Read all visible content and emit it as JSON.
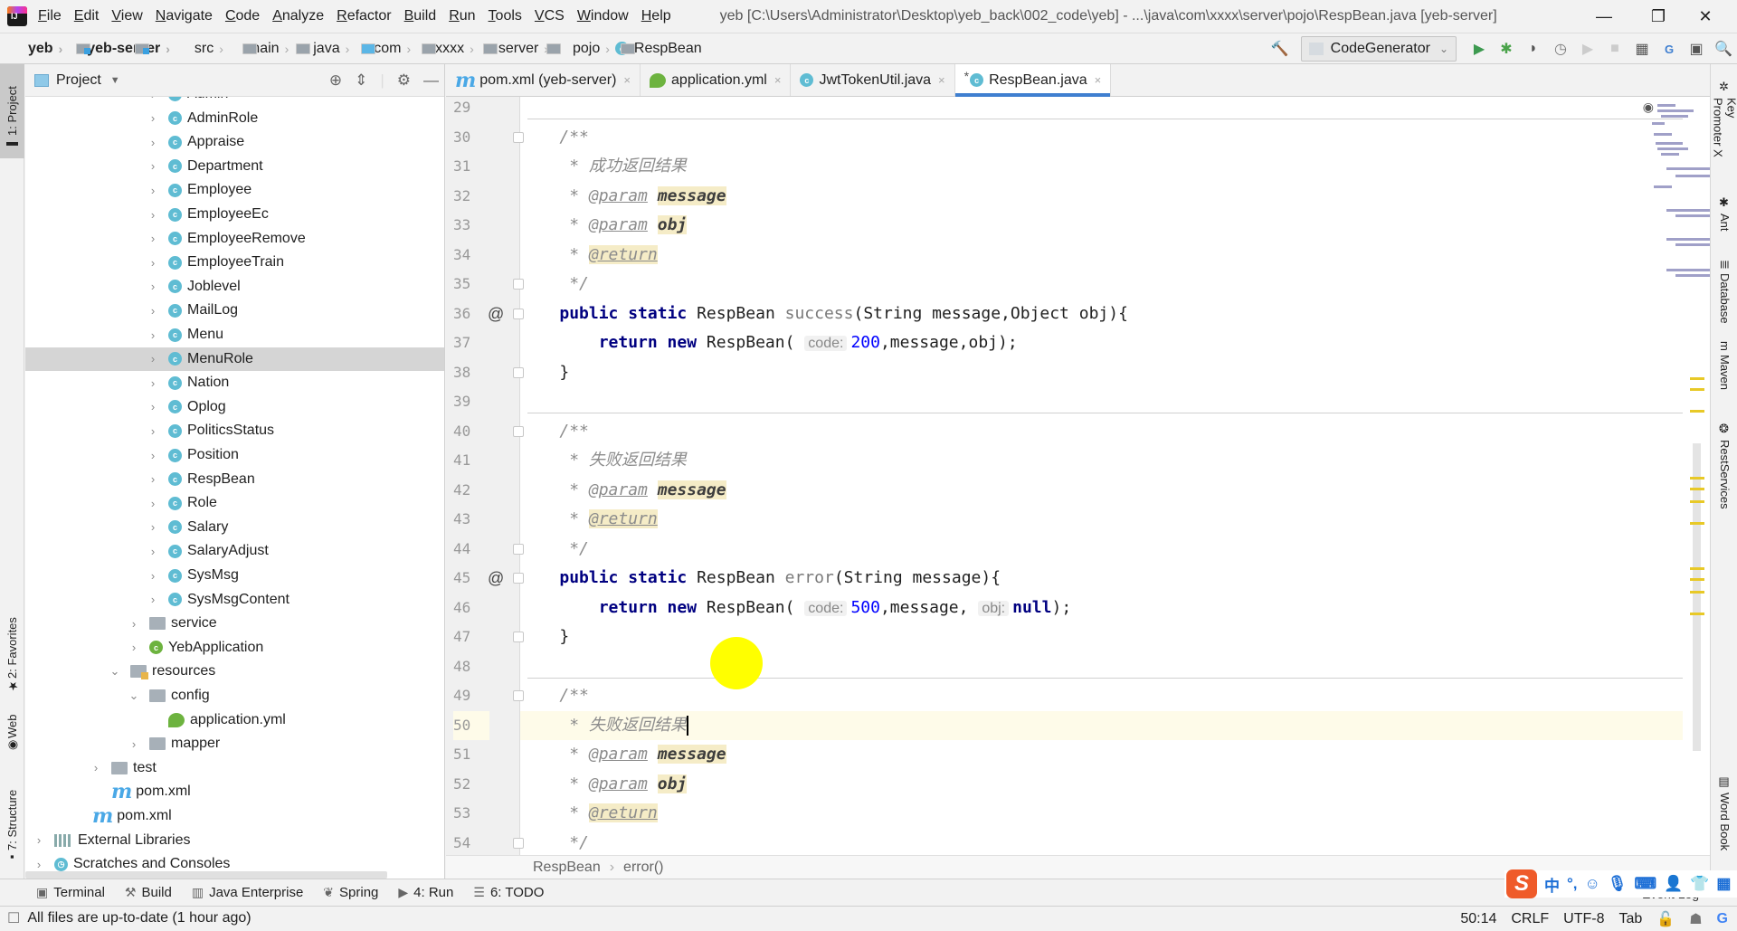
{
  "window": {
    "title": "yeb [C:\\Users\\Administrator\\Desktop\\yeb_back\\002_code\\yeb] - ...\\java\\com\\xxxx\\server\\pojo\\RespBean.java [yeb-server]",
    "minimize": "—",
    "maximize": "❐",
    "close": "✕"
  },
  "menu": [
    "File",
    "Edit",
    "View",
    "Navigate",
    "Code",
    "Analyze",
    "Refactor",
    "Build",
    "Run",
    "Tools",
    "VCS",
    "Window",
    "Help"
  ],
  "breadcrumb": [
    "yeb",
    "yeb-server",
    "src",
    "main",
    "java",
    "com",
    "xxxx",
    "server",
    "pojo",
    "RespBean"
  ],
  "toolbar": {
    "run_config": "CodeGenerator",
    "icons": [
      "hammer-icon",
      "run-icon",
      "debug-icon",
      "coverage-icon",
      "profile-icon",
      "run-disabled-icon",
      "stop-icon",
      "project-structure-icon",
      "translate-icon",
      "terminal-icon",
      "search-icon"
    ]
  },
  "left_stripe": {
    "top": [
      "1: Project"
    ],
    "bottom": [
      "2: Favorites",
      "Web",
      "7: Structure"
    ]
  },
  "right_stripe": [
    "Key Promoter X",
    "Ant",
    "Database",
    "Maven",
    "RestServices",
    "Word Book"
  ],
  "project_panel": {
    "title": "Project",
    "tree": [
      {
        "label": "Admin",
        "type": "class",
        "indent": 6,
        "arrow": "›"
      },
      {
        "label": "AdminRole",
        "type": "class",
        "indent": 6,
        "arrow": "›"
      },
      {
        "label": "Appraise",
        "type": "class",
        "indent": 6,
        "arrow": "›"
      },
      {
        "label": "Department",
        "type": "class",
        "indent": 6,
        "arrow": "›"
      },
      {
        "label": "Employee",
        "type": "class",
        "indent": 6,
        "arrow": "›"
      },
      {
        "label": "EmployeeEc",
        "type": "class",
        "indent": 6,
        "arrow": "›"
      },
      {
        "label": "EmployeeRemove",
        "type": "class",
        "indent": 6,
        "arrow": "›"
      },
      {
        "label": "EmployeeTrain",
        "type": "class",
        "indent": 6,
        "arrow": "›"
      },
      {
        "label": "Joblevel",
        "type": "class",
        "indent": 6,
        "arrow": "›"
      },
      {
        "label": "MailLog",
        "type": "class",
        "indent": 6,
        "arrow": "›"
      },
      {
        "label": "Menu",
        "type": "class",
        "indent": 6,
        "arrow": "›"
      },
      {
        "label": "MenuRole",
        "type": "class",
        "indent": 6,
        "arrow": "›",
        "selected": true
      },
      {
        "label": "Nation",
        "type": "class",
        "indent": 6,
        "arrow": "›"
      },
      {
        "label": "Oplog",
        "type": "class",
        "indent": 6,
        "arrow": "›"
      },
      {
        "label": "PoliticsStatus",
        "type": "class",
        "indent": 6,
        "arrow": "›"
      },
      {
        "label": "Position",
        "type": "class",
        "indent": 6,
        "arrow": "›"
      },
      {
        "label": "RespBean",
        "type": "class",
        "indent": 6,
        "arrow": "›"
      },
      {
        "label": "Role",
        "type": "class",
        "indent": 6,
        "arrow": "›"
      },
      {
        "label": "Salary",
        "type": "class",
        "indent": 6,
        "arrow": "›"
      },
      {
        "label": "SalaryAdjust",
        "type": "class",
        "indent": 6,
        "arrow": "›"
      },
      {
        "label": "SysMsg",
        "type": "class",
        "indent": 6,
        "arrow": "›"
      },
      {
        "label": "SysMsgContent",
        "type": "class",
        "indent": 6,
        "arrow": "›"
      },
      {
        "label": "service",
        "type": "folder",
        "indent": 5,
        "arrow": "›"
      },
      {
        "label": "YebApplication",
        "type": "spring-class",
        "indent": 5,
        "arrow": "›"
      },
      {
        "label": "resources",
        "type": "res-folder",
        "indent": 4,
        "arrow": "⌄"
      },
      {
        "label": "config",
        "type": "folder",
        "indent": 5,
        "arrow": "⌄"
      },
      {
        "label": "application.yml",
        "type": "yml",
        "indent": 6,
        "arrow": ""
      },
      {
        "label": "mapper",
        "type": "folder",
        "indent": 5,
        "arrow": "›"
      },
      {
        "label": "test",
        "type": "folder",
        "indent": 3,
        "arrow": "›"
      },
      {
        "label": "pom.xml",
        "type": "maven",
        "indent": 3,
        "arrow": ""
      },
      {
        "label": "pom.xml",
        "type": "maven",
        "indent": 2,
        "arrow": ""
      },
      {
        "label": "External Libraries",
        "type": "libs",
        "indent": 0,
        "arrow": "›"
      },
      {
        "label": "Scratches and Consoles",
        "type": "scratches",
        "indent": 0,
        "arrow": "›"
      }
    ]
  },
  "editor_tabs": [
    {
      "label": "pom.xml (yeb-server)",
      "icon": "maven",
      "active": false
    },
    {
      "label": "application.yml",
      "icon": "yml",
      "active": false
    },
    {
      "label": "JwtTokenUtil.java",
      "icon": "class",
      "active": false
    },
    {
      "label": "RespBean.java",
      "icon": "class",
      "active": true,
      "modified": true
    }
  ],
  "editor": {
    "cursor_line": 50,
    "lines": [
      {
        "n": 29,
        "html": ""
      },
      {
        "n": 30,
        "html": "    <span class='cm'>/**</span>"
      },
      {
        "n": 31,
        "html": "     <span class='cm'>* 成功返回结果</span>"
      },
      {
        "n": 32,
        "html": "     <span class='cm'>* </span><span class='tag'>@param</span> <span class='pname'>message</span>"
      },
      {
        "n": 33,
        "html": "     <span class='cm'>* </span><span class='tag'>@param</span> <span class='pname'>obj</span>"
      },
      {
        "n": 34,
        "html": "     <span class='cm'>* </span><span class='tag hl'>@return</span>"
      },
      {
        "n": 35,
        "html": "     <span class='cm'>*/</span>"
      },
      {
        "n": 36,
        "html": "    <span class='kw'>public static</span> RespBean <span class='fn'>success</span>(String message,Object obj){",
        "at": true
      },
      {
        "n": 37,
        "html": "        <span class='kw'>return new</span> RespBean( <span class='hint'>code:</span><span class='num'>200</span>,message,obj);"
      },
      {
        "n": 38,
        "html": "    }"
      },
      {
        "n": 39,
        "html": ""
      },
      {
        "n": 40,
        "html": "    <span class='cm'>/**</span>"
      },
      {
        "n": 41,
        "html": "     <span class='cm'>* 失败返回结果</span>"
      },
      {
        "n": 42,
        "html": "     <span class='cm'>* </span><span class='tag'>@param</span> <span class='pname'>message</span>"
      },
      {
        "n": 43,
        "html": "     <span class='cm'>* </span><span class='tag hl'>@return</span>"
      },
      {
        "n": 44,
        "html": "     <span class='cm'>*/</span>"
      },
      {
        "n": 45,
        "html": "    <span class='kw'>public static</span> RespBean <span class='fn'>error</span>(String message){",
        "at": true
      },
      {
        "n": 46,
        "html": "        <span class='kw'>return new</span> RespBean( <span class='hint'>code:</span><span class='num'>500</span>,message, <span class='hint'>obj:</span><span class='kw'>null</span>);"
      },
      {
        "n": 47,
        "html": "    }"
      },
      {
        "n": 48,
        "html": ""
      },
      {
        "n": 49,
        "html": "    <span class='cm'>/**</span>"
      },
      {
        "n": 50,
        "html": "     <span class='cm'>* 失败返回结果</span><span class='caret'></span>"
      },
      {
        "n": 51,
        "html": "     <span class='cm'>* </span><span class='tag'>@param</span> <span class='pname'>message</span>"
      },
      {
        "n": 52,
        "html": "     <span class='cm'>* </span><span class='tag'>@param</span> <span class='pname'>obj</span>"
      },
      {
        "n": 53,
        "html": "     <span class='cm'>* </span><span class='tag hl'>@return</span>"
      },
      {
        "n": 54,
        "html": "     <span class='cm'>*/</span>"
      }
    ]
  },
  "editor_breadcrumb": [
    "RespBean",
    "error()"
  ],
  "bottom_tools": [
    {
      "label": "Terminal",
      "icon": "terminal-icon"
    },
    {
      "label": "Build",
      "icon": "hammer-icon"
    },
    {
      "label": "Java Enterprise",
      "icon": "java-enterprise-icon"
    },
    {
      "label": "Spring",
      "icon": "spring-icon"
    },
    {
      "label": "4: Run",
      "icon": "run-icon"
    },
    {
      "label": "6: TODO",
      "icon": "todo-icon"
    }
  ],
  "event_log": "Event Log",
  "status": {
    "message": "All files are up-to-date (1 hour ago)",
    "position": "50:14",
    "line_sep": "CRLF",
    "encoding": "UTF-8",
    "indent": "Tab"
  },
  "ime": {
    "lang": "中",
    "punct": "°,",
    "items": [
      "emoji-icon",
      "microphone-icon",
      "keyboard-icon",
      "user-icon",
      "skin-icon",
      "grid-icon"
    ]
  }
}
